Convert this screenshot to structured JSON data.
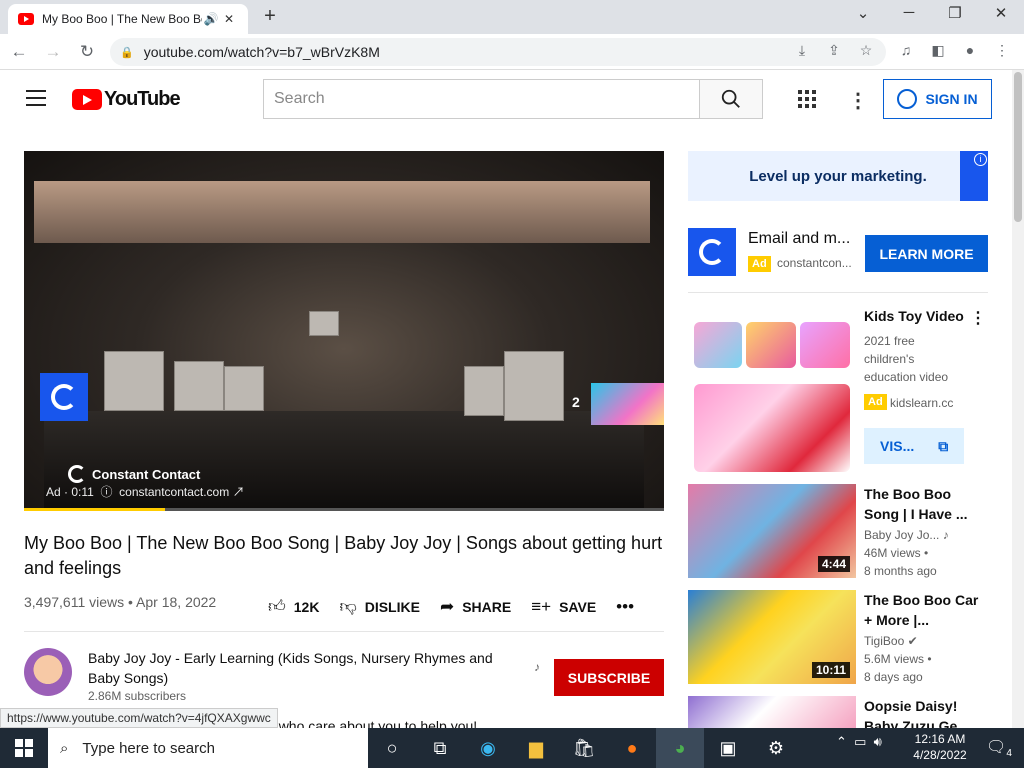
{
  "browser": {
    "tab_title": "My Boo Boo | The New Boo Boo Song",
    "url": "youtube.com/watch?v=b7_wBrVzK8M",
    "status_url": "https://www.youtube.com/watch?v=4jfQXAXgwwc"
  },
  "header": {
    "logo_text": "YouTube",
    "search_placeholder": "Search",
    "signin_label": "SIGN IN"
  },
  "player": {
    "brand": "Constant Contact",
    "ad_time": "Ad · 0:11",
    "ad_domain": "constantcontact.com",
    "skip_count": "2",
    "progress": 0.22
  },
  "video": {
    "title": "My Boo Boo | The New Boo Boo Song | Baby Joy Joy | Songs about getting hurt and feelings",
    "views_date": "3,497,611 views • Apr 18, 2022",
    "like_count": "12K",
    "dislike_label": "DISLIKE",
    "share_label": "SHARE",
    "save_label": "SAVE",
    "channel_name": "Baby Joy Joy - Early Learning (Kids Songs, Nursery Rhymes and Baby Songs)",
    "subscribers": "2.86M subscribers",
    "subscribe_label": "SUBSCRIBE",
    "description_snippet": "your parents and other people who care about you to help you!"
  },
  "sidebar": {
    "banner_text": "Level up your marketing.",
    "ad_title": "Email and m...",
    "ad_badge": "Ad",
    "ad_domain": "constantcon...",
    "learn_more": "LEARN MORE",
    "kids": {
      "title": "Kids Toy Video",
      "desc": "2021 free children's education video",
      "badge": "Ad",
      "domain": "kidslearn.cc",
      "visit": "VIS..."
    },
    "recs": [
      {
        "title": "The Boo Boo Song | I Have ...",
        "channel": "Baby Joy Jo...",
        "views": "46M views •",
        "age": "8 months ago",
        "duration": "4:44"
      },
      {
        "title": "The Boo Boo Car + More |...",
        "channel": "TigiBoo",
        "views": "5.6M views •",
        "age": "8 days ago",
        "duration": "10:11"
      },
      {
        "title": "Oopsie Daisy! Baby Zuzu Ge...",
        "channel": "",
        "views": "",
        "age": "",
        "duration": ""
      }
    ]
  },
  "taskbar": {
    "search_placeholder": "Type here to search",
    "time": "12:16 AM",
    "date": "4/28/2022",
    "notif_count": "4"
  },
  "colors": {
    "accent": "#065fd4",
    "brand": "#ff0000",
    "subscribe": "#cc0000",
    "ad_yellow": "#ffcc00"
  }
}
